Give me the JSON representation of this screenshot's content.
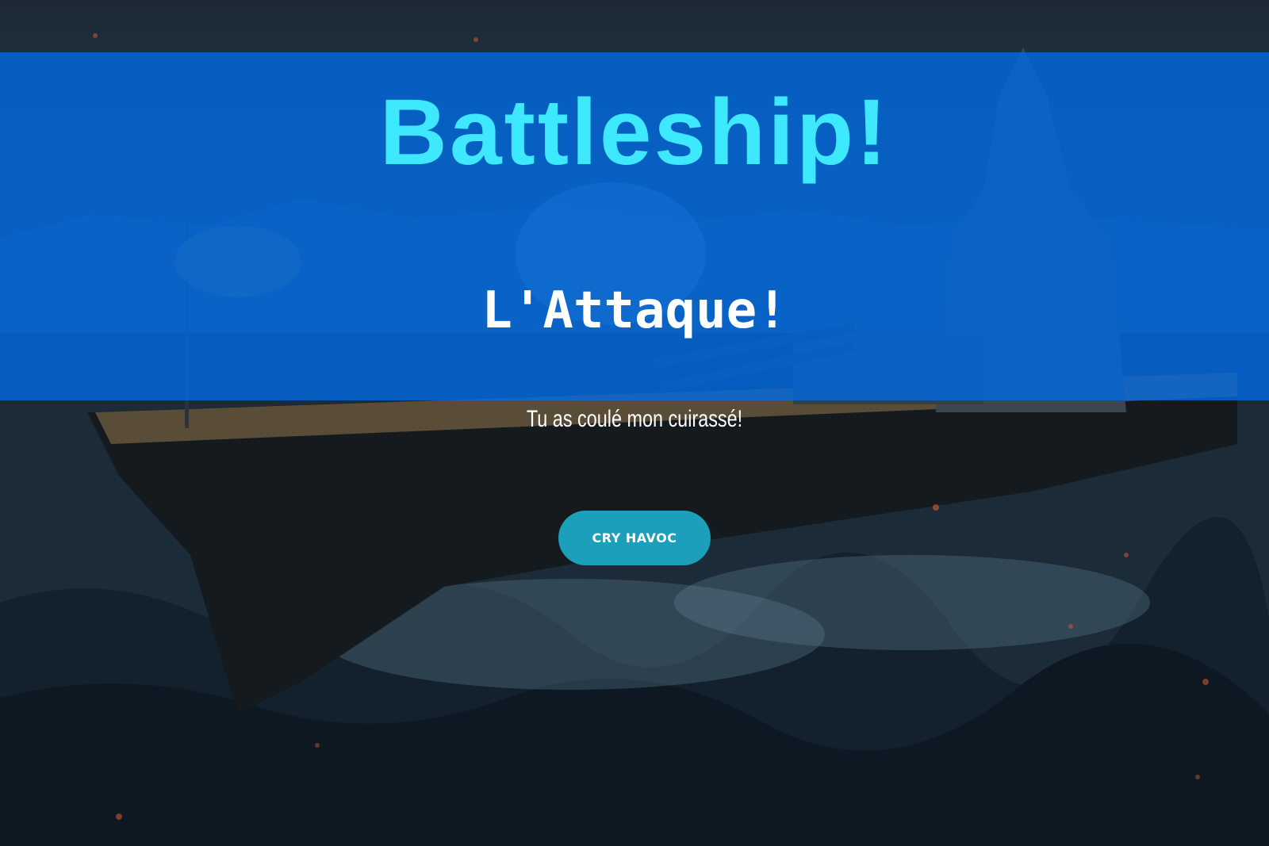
{
  "hero": {
    "title": "Battleship!",
    "subtitle": "L'Attaque!",
    "tagline": "Tu as coulé mon cuirassé!",
    "cta_label": "CRY HAVOC"
  },
  "colors": {
    "band": "#006ce6",
    "title": "#3ee8ff",
    "button": "#1b9fba",
    "text": "#ffffff"
  },
  "background": {
    "description_icon": "battleship-scene-image"
  }
}
